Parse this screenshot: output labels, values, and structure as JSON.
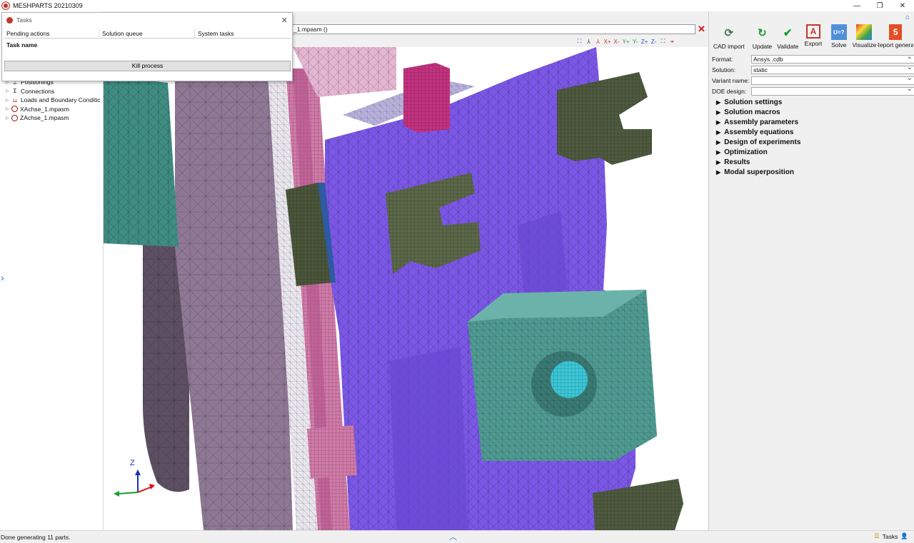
{
  "window": {
    "title": "MESHPARTS 20210309"
  },
  "tasks": {
    "title": "Tasks",
    "tabs": [
      "Pending actions",
      "Solution queue",
      "System tasks"
    ],
    "column_header": "Task name",
    "kill_label": "Kill process"
  },
  "path": {
    "value": "_1.mpasm ()"
  },
  "tree": {
    "items": [
      {
        "label": "Positionings"
      },
      {
        "label": "Connections"
      },
      {
        "label": "Loads and Boundary Conditic"
      },
      {
        "label": "XAchse_1.mpasm"
      },
      {
        "label": "ZAchse_1.mpasm"
      }
    ]
  },
  "view_toolbar": [
    "⛶",
    "⅄",
    "⅄",
    "X+",
    "X-",
    "Y+",
    "Y-",
    "Z+",
    "Z-",
    "⛶",
    "⚭"
  ],
  "ribbon": {
    "buttons": [
      {
        "label": "CAD import",
        "icon": "cad-import-icon"
      },
      {
        "label": "Update",
        "icon": "update-icon"
      },
      {
        "label": "Validate",
        "icon": "validate-icon"
      },
      {
        "label": "Export",
        "icon": "export-icon"
      },
      {
        "label": "Solve",
        "icon": "solve-icon",
        "glyph": "U=?"
      },
      {
        "label": "Visualize",
        "icon": "visualize-icon"
      },
      {
        "label": "Report generat",
        "icon": "report-icon"
      }
    ]
  },
  "form": {
    "format_label": "Format:",
    "format_value": "Ansys .cdb",
    "solution_label": "Solution:",
    "solution_value": "static",
    "variant_label": "Variant name:",
    "variant_value": "",
    "doe_label": "DOE design:",
    "doe_value": ""
  },
  "sections": [
    "Solution settings",
    "Solution macros",
    "Assembly parameters",
    "Assembly equations",
    "Design of experiments",
    "Optimization",
    "Results",
    "Modal superposition"
  ],
  "axes": {
    "z_label": "Z"
  },
  "status": {
    "message": "Done generating 11 parts.",
    "tasks_label": "Tasks"
  },
  "colors": {
    "purple_part": "#7b57e6",
    "teal_part": "#3f8c82",
    "olive_part": "#4e5a3f",
    "pink_part": "#d07aa8",
    "magenta_part": "#c2327f",
    "mauve_part": "#8e7894",
    "cyan_part": "#3bc6d6"
  }
}
